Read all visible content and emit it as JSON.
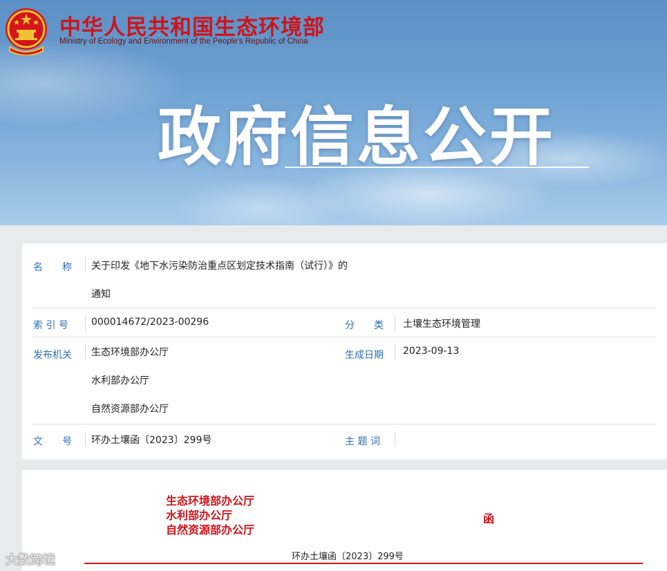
{
  "header": {
    "ministry_cn": "中华人民共和国生态环境部",
    "ministry_en": "Ministry of Ecology and Environment of the People's Republic of China",
    "banner_title": "政府信息公开",
    "emblem_icon": "national-emblem-icon"
  },
  "info": {
    "name_label": "名　　称",
    "name_line1": "关于印发《地下水污染防治重点区划定技术指南（试行）》的",
    "name_line2": "通知",
    "index_label": "索 引 号",
    "index_value": "000014672/2023-00296",
    "category_label": "分　　类",
    "category_value": "土壤生态环境管理",
    "issuer_label": "发布机关",
    "issuers": [
      "生态环境部办公厅",
      "水利部办公厅",
      "自然资源部办公厅"
    ],
    "date_label": "生成日期",
    "date_value": "2023-09-13",
    "docno_label": "文　　号",
    "docno_value": "环办土壤函〔2023〕299号",
    "keywords_label": "主 题 词",
    "keywords_value": ""
  },
  "document": {
    "issuers": [
      "生态环境部办公厅",
      "水利部办公厅",
      "自然资源部办公厅"
    ],
    "han": "函",
    "docno": "环办土壤函〔2023〕299号"
  },
  "watermark": "大数跨境",
  "colors": {
    "red": "#d0131a",
    "label_blue": "#2a6db5",
    "sky": "#6b9fd0"
  }
}
